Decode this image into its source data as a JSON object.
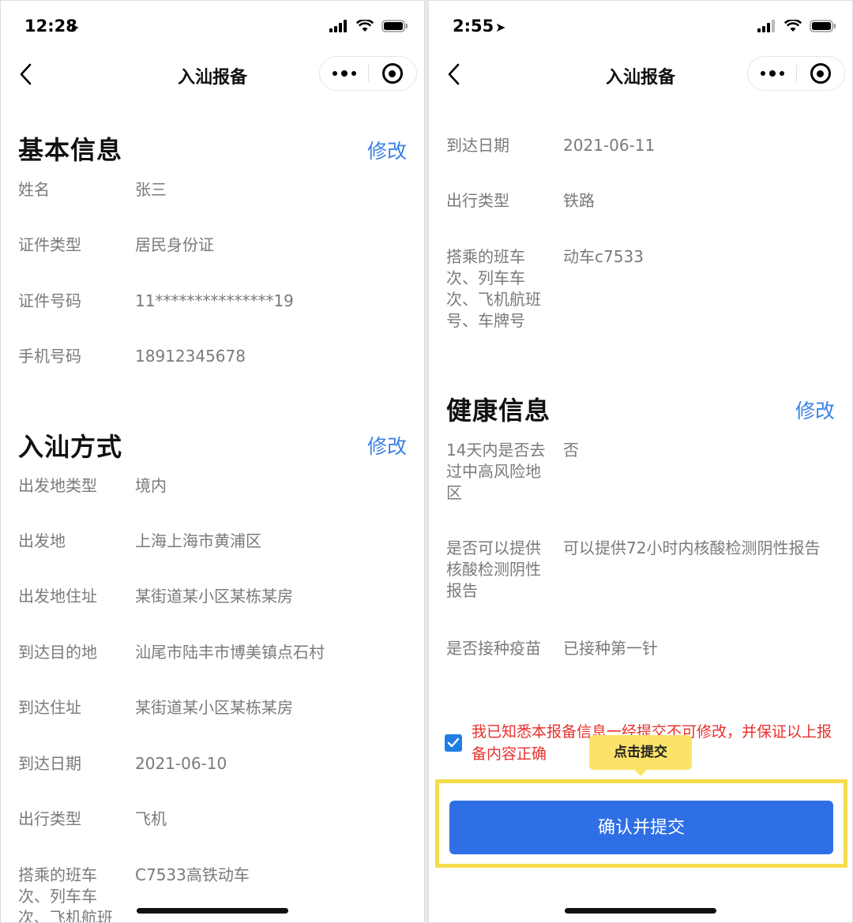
{
  "left": {
    "status": {
      "time": "12:28"
    },
    "nav": {
      "title": "入汕报备"
    },
    "basic": {
      "title": "基本信息",
      "edit": "修改",
      "rows": [
        {
          "label": "姓名",
          "value": "张三"
        },
        {
          "label": "证件类型",
          "value": "居民身份证"
        },
        {
          "label": "证件号码",
          "value": "11***************19"
        },
        {
          "label": "手机号码",
          "value": "18912345678"
        }
      ]
    },
    "method": {
      "title": "入汕方式",
      "edit": "修改",
      "rows": [
        {
          "label": "出发地类型",
          "value": "境内"
        },
        {
          "label": "出发地",
          "value": "上海上海市黄浦区"
        },
        {
          "label": "出发地住址",
          "value": "某街道某小区某栋某房"
        },
        {
          "label": "到达目的地",
          "value": "汕尾市陆丰市博美镇点石村"
        },
        {
          "label": "到达住址",
          "value": "某街道某小区某栋某房"
        },
        {
          "label": "到达日期",
          "value": "2021-06-10"
        },
        {
          "label": "出行类型",
          "value": "飞机"
        },
        {
          "label": "搭乘的班车次、列车车次、飞机航班",
          "value": "C7533高铁动车"
        }
      ]
    }
  },
  "right": {
    "status": {
      "time": "2:55"
    },
    "nav": {
      "title": "入汕报备"
    },
    "travel_rows": [
      {
        "label": "到达日期",
        "value": "2021-06-11"
      },
      {
        "label": "出行类型",
        "value": "铁路"
      },
      {
        "label": "搭乘的班车次、列车车次、飞机航班号、车牌号",
        "value": "动车c7533"
      }
    ],
    "health": {
      "title": "健康信息",
      "edit": "修改",
      "rows": [
        {
          "label": "14天内是否去过中高风险地区",
          "value": "否"
        },
        {
          "label": "是否可以提供核酸检测阴性报告",
          "value": "可以提供72小时内核酸检测阴性报告"
        },
        {
          "label": "是否接种疫苗",
          "value": "已接种第一针"
        }
      ]
    },
    "consent_text": "我已知悉本报备信息一经提交不可修改，并保证以上报备内容正确",
    "tooltip": "点击提交",
    "submit_label": "确认并提交"
  }
}
